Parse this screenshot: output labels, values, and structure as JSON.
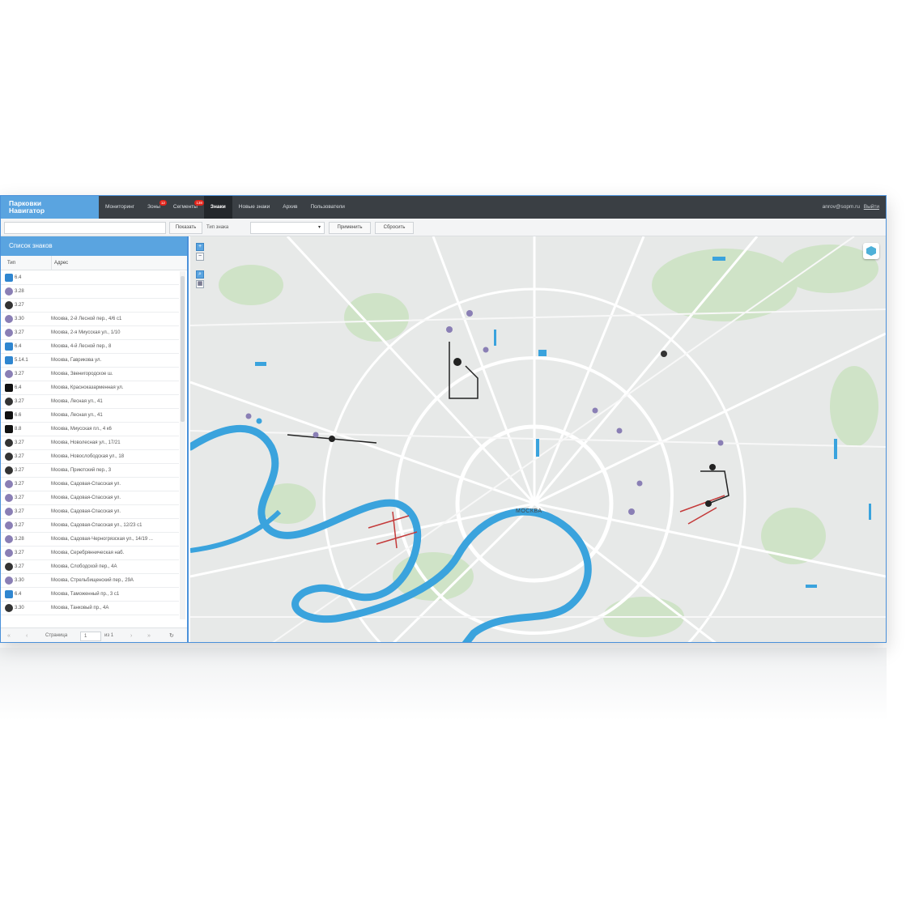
{
  "app": {
    "brand_line1": "Парковки",
    "brand_line2": "Навигатор",
    "user_email": "anrov@sopm.ru",
    "logout_label": "Выйти"
  },
  "nav": [
    {
      "label": "Мониторинг"
    },
    {
      "label": "Зоны",
      "badge": "12"
    },
    {
      "label": "Сегменты",
      "badge": "138"
    },
    {
      "label": "Знаки",
      "active": true
    },
    {
      "label": "Новые знаки"
    },
    {
      "label": "Архив"
    },
    {
      "label": "Пользователи"
    }
  ],
  "toolbar": {
    "search_placeholder": "",
    "show_label": "Показать",
    "type_label": "Тип знака",
    "type_value": "",
    "apply_label": "Применить",
    "reset_label": "Сбросить"
  },
  "panel": {
    "title": "Список знаков",
    "col_type": "Тип",
    "col_address": "Адрес",
    "rows": [
      {
        "type": "6.4",
        "icon": "blue",
        "address": ""
      },
      {
        "type": "3.28",
        "icon": "purple",
        "address": ""
      },
      {
        "type": "3.27",
        "icon": "dark",
        "address": ""
      },
      {
        "type": "3.30",
        "icon": "purple",
        "address": "Москва, 2-й Лесной пер., 4/6 с1"
      },
      {
        "type": "3.27",
        "icon": "purple",
        "address": "Москва, 2-я Миусская ул., 1/10"
      },
      {
        "type": "6.4",
        "icon": "blue",
        "address": "Москва, 4-й Лесной пер., 8"
      },
      {
        "type": "5.14.1",
        "icon": "blue",
        "address": "Москва, Гаврикова ул."
      },
      {
        "type": "3.27",
        "icon": "purple",
        "address": "Москва, Звенигородское ш."
      },
      {
        "type": "6.4",
        "icon": "black",
        "address": "Москва, Красноказарменная ул."
      },
      {
        "type": "3.27",
        "icon": "dark",
        "address": "Москва, Лесная ул., 41"
      },
      {
        "type": "6.6",
        "icon": "black",
        "address": "Москва, Лесная ул., 41"
      },
      {
        "type": "8.8",
        "icon": "black",
        "address": "Москва, Миусская пл., 4 к6"
      },
      {
        "type": "3.27",
        "icon": "dark",
        "address": "Москва, Новолесная ул., 17/21"
      },
      {
        "type": "3.27",
        "icon": "dark",
        "address": "Москва, Новослободская ул., 18"
      },
      {
        "type": "3.27",
        "icon": "dark",
        "address": "Москва, Приютский пер., 3"
      },
      {
        "type": "3.27",
        "icon": "purple",
        "address": "Москва, Садовая-Спасская ул."
      },
      {
        "type": "3.27",
        "icon": "purple",
        "address": "Москва, Садовая-Спасская ул."
      },
      {
        "type": "3.27",
        "icon": "purple",
        "address": "Москва, Садовая-Спасская ул."
      },
      {
        "type": "3.27",
        "icon": "purple",
        "address": "Москва, Садовая-Спасская ул., 12/23 с1"
      },
      {
        "type": "3.28",
        "icon": "purple",
        "address": "Москва, Садовая-Черногрязская ул., 14/19 ..."
      },
      {
        "type": "3.27",
        "icon": "purple",
        "address": "Москва, Серебрянническая наб."
      },
      {
        "type": "3.27",
        "icon": "dark",
        "address": "Москва, Слободской пер., 4А"
      },
      {
        "type": "3.30",
        "icon": "purple",
        "address": "Москва, Стрельбищенский пер., 29А"
      },
      {
        "type": "6.4",
        "icon": "blue",
        "address": "Москва, Таможенный пр., 3 с1"
      },
      {
        "type": "3.30",
        "icon": "dark",
        "address": "Москва, Танковый пр., 4А"
      }
    ],
    "pager": {
      "page_label": "Страница",
      "page_value": "1",
      "of_label": "из 1"
    }
  },
  "map": {
    "city_label": "МОСКВА",
    "zoom_in": "+",
    "zoom_out": "−",
    "colors": {
      "water": "#3aa3dd",
      "roads": "#ffffff",
      "parks": "#cfe3c7",
      "land": "#e7e9e8"
    }
  }
}
